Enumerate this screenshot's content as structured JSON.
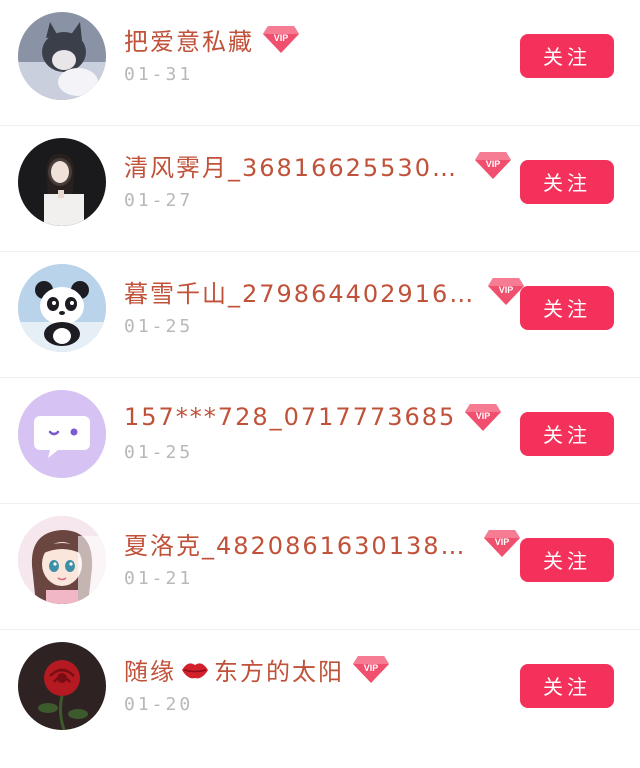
{
  "colors": {
    "name_text": "#c0523a",
    "date_text": "#b8b8b8",
    "follow_button_bg": "#f3315b",
    "follow_button_text": "#ffffff",
    "vip_badge": "#f0506e",
    "divider": "#f0f0f0"
  },
  "follow_label": "关注",
  "vip_label": "VIP",
  "users": [
    {
      "name": "把爱意私藏",
      "date": "01-31",
      "avatar_icon": "cat-avatar-icon"
    },
    {
      "name": "清风霁月_36816625530…",
      "date": "01-27",
      "avatar_icon": "girl-portrait-avatar-icon"
    },
    {
      "name": "暮雪千山_279864402916…",
      "date": "01-25",
      "avatar_icon": "panda-avatar-icon"
    },
    {
      "name": "157***728_0717773685",
      "date": "01-25",
      "avatar_icon": "chat-bubble-avatar-icon"
    },
    {
      "name": "夏洛克_4820861630138…",
      "date": "01-21",
      "avatar_icon": "anime-girl-avatar-icon"
    },
    {
      "name_part1": "随缘",
      "name_part2": "东方的太阳",
      "name_emoji": "lips-emoji-icon",
      "date": "01-20",
      "avatar_icon": "rose-avatar-icon"
    }
  ]
}
